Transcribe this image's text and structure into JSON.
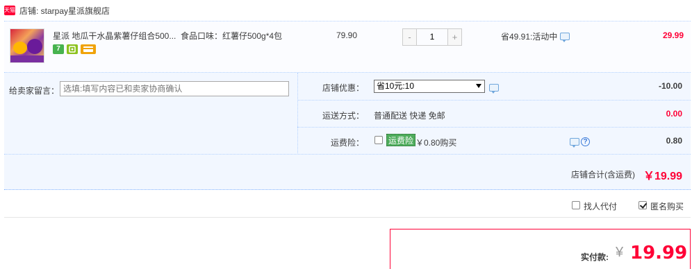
{
  "shop": {
    "badge_text": "天猫",
    "label": "店铺: starpay星派旗舰店"
  },
  "item": {
    "title": "星派 地瓜干水晶紫薯仔组合500...",
    "sku": "食品口味：红薯仔500g*4包",
    "tags": [
      "7",
      "badge-icon",
      "card-icon"
    ],
    "tag_seven": "7",
    "unit_price": "79.90",
    "quantity": "1",
    "qty_minus": "-",
    "qty_plus": "+",
    "promo": "省49.91:活动中",
    "subtotal": "29.99"
  },
  "options": {
    "memo_label": "给卖家留言：",
    "memo_placeholder": "选填:填写内容已和卖家协商确认",
    "coupon_label": "店铺优惠：",
    "coupon_selected": "省10元:10",
    "coupon_value": "-10.00",
    "shipping_label": "运送方式：",
    "shipping_text": "普通配送 快递 免邮",
    "shipping_value": "0.00",
    "insurance_label": "运费险：",
    "insurance_tag": "运费险",
    "insurance_text": "￥0.80购买",
    "insurance_value": "0.80",
    "help_glyph": "?"
  },
  "shop_total": {
    "label": "店铺合计(含运费)",
    "amount": "￥19.99"
  },
  "proxy": {
    "proxy_label": "找人代付",
    "proxy_checked": false,
    "anonymous_label": "匿名购买",
    "anonymous_checked": true
  },
  "payment": {
    "label": "实付款:",
    "currency": "¥",
    "amount": "19.99"
  },
  "colors": {
    "accent_red": "#ff0036",
    "panel_blue": "#f2f7ff",
    "divider_blue": "#b2d1ff"
  }
}
